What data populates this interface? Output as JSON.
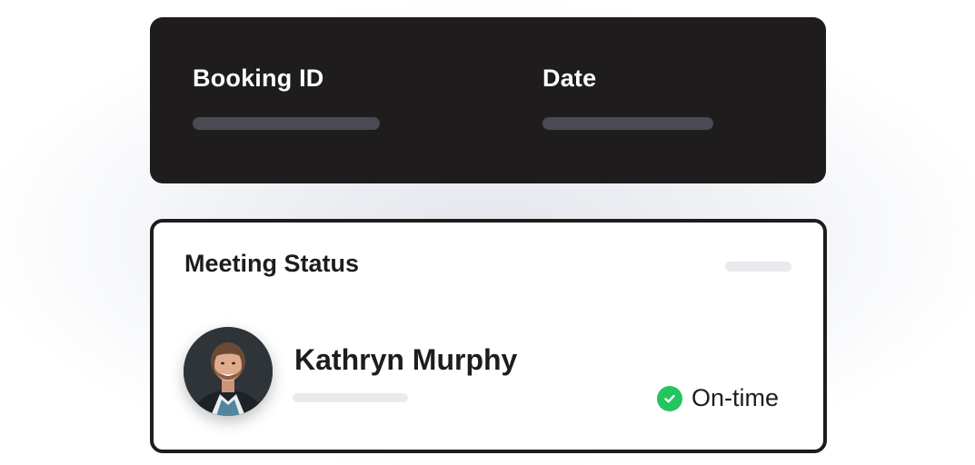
{
  "booking": {
    "id_label": "Booking ID",
    "date_label": "Date"
  },
  "meeting": {
    "title": "Meeting Status",
    "person": {
      "name": "Kathryn Murphy"
    },
    "status": {
      "label": "On-time",
      "icon": "check-circle-icon",
      "color": "#22c55e"
    }
  },
  "colors": {
    "dark_card": "#1f1c1d",
    "placeholder_dark": "#4a4a55",
    "placeholder_light": "#e8eaee"
  }
}
